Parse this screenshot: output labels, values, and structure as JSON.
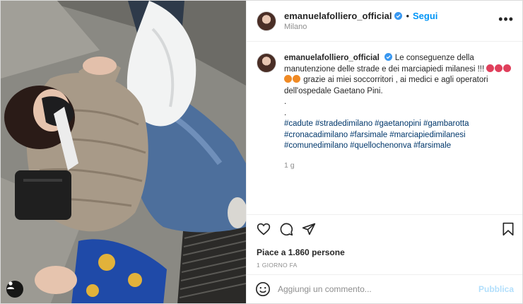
{
  "post": {
    "username": "emanuelafolliero_official",
    "follow_label": "Segui",
    "separator": "•",
    "location": "Milano",
    "more_label": "•••",
    "caption": {
      "username": "emanuelafolliero_official",
      "text_before_emoji": "Le conseguenze della manutenzione delle strade e dei marciapiedi milanesi !!!",
      "text_after_emoji": "grazie ai miei soccorritori , ai medici e agli operatori dell'ospedale Gaetano Pini.",
      "dot_lines": [
        ".",
        "."
      ],
      "hashtags": [
        "#cadute",
        "#stradedimilano",
        "#gaetanopini",
        "#gambarotta",
        "#cronacadimilano",
        "#farsimale",
        "#marciapiedimilanesi",
        "#comunedimilano",
        "#quellochenonva",
        "#farsimale"
      ],
      "time_ago": "1 g"
    },
    "likes_text": "Piace a 1.860 persone",
    "date_text": "1 GIORNO FA",
    "comment_placeholder": "Aggiungi un commento...",
    "publish_label": "Pubblica"
  },
  "icons": {
    "verified": "verified-badge-icon",
    "like": "heart-icon",
    "comment": "comment-icon",
    "share": "paper-plane-icon",
    "save": "bookmark-icon",
    "emoji": "smiley-icon",
    "tag": "user-tag-icon"
  },
  "colors": {
    "accent": "#0095f6",
    "hashtag": "#00376b",
    "muted": "#8e8e8e",
    "publish_disabled": "#b2dffc"
  }
}
